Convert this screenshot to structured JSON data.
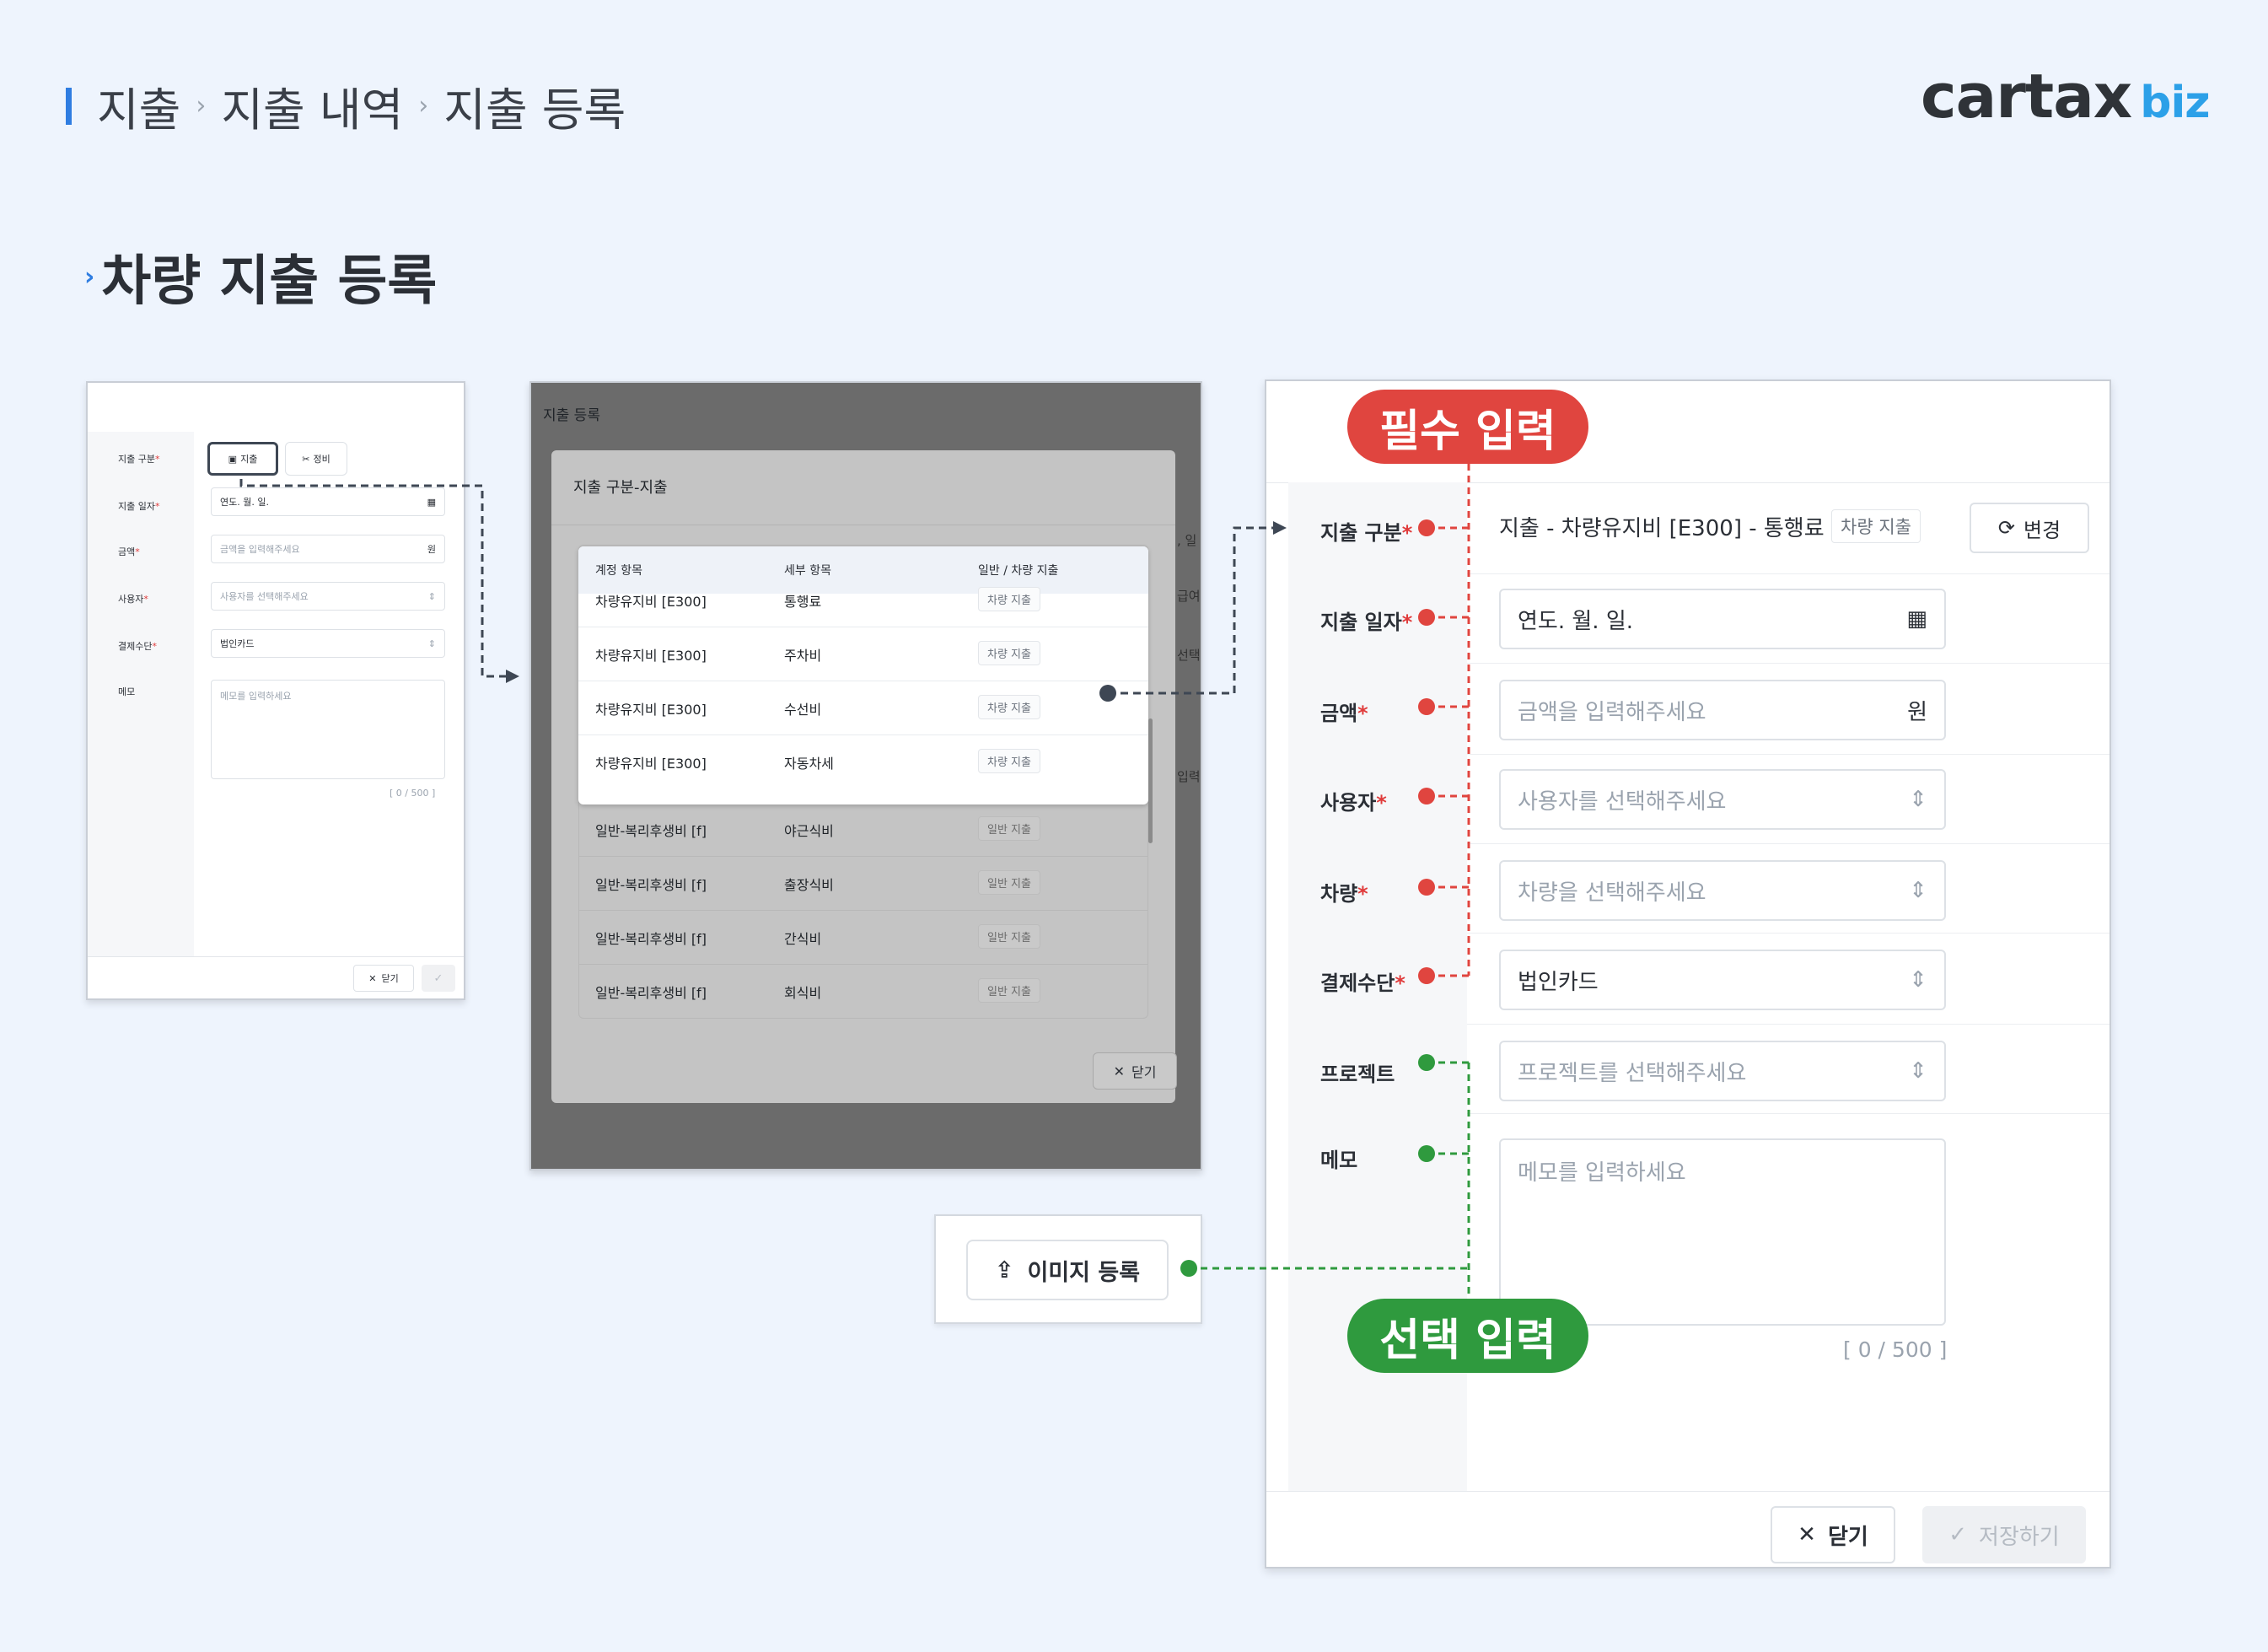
{
  "breadcrumb": {
    "items": [
      "지출",
      "지출 내역",
      "지출 등록"
    ]
  },
  "logo": {
    "text": "cartax",
    "suffix": "biz"
  },
  "section_title": "차량 지출 등록",
  "small_form": {
    "labels": {
      "category": "지출 구분",
      "date": "지출 일자",
      "amount": "금액",
      "user": "사용자",
      "payment": "결제수단",
      "memo": "메모"
    },
    "req_mark": "*",
    "switch_expense": "지출",
    "switch_maintenance": "정비",
    "date_value": "연도. 월. 일.",
    "amount_placeholder": "금액을 입력해주세요",
    "amount_unit": "원",
    "user_placeholder": "사용자를 선택해주세요",
    "payment_value": "법인카드",
    "memo_placeholder": "메모를 입력하세요",
    "memo_counter": "[ 0 / 500 ]",
    "close_label": "닫기"
  },
  "modal": {
    "page_title": "지출 등록",
    "title": "지출 구분-지출",
    "columns": [
      "계정 항목",
      "세부 항목",
      "일반 / 차량 지출"
    ],
    "rows": [
      {
        "account": "차량유지비 [E300]",
        "detail": "통행료",
        "type": "차량 지출"
      },
      {
        "account": "차량유지비 [E300]",
        "detail": "주차비",
        "type": "차량 지출"
      },
      {
        "account": "차량유지비 [E300]",
        "detail": "수선비",
        "type": "차량 지출"
      },
      {
        "account": "차량유지비 [E300]",
        "detail": "자동차세",
        "type": "차량 지출"
      },
      {
        "account": "일반-복리후생비 [f]",
        "detail": "야근식비",
        "type": "일반 지출"
      },
      {
        "account": "일반-복리후생비 [f]",
        "detail": "출장식비",
        "type": "일반 지출"
      },
      {
        "account": "일반-복리후생비 [f]",
        "detail": "간식비",
        "type": "일반 지출"
      },
      {
        "account": "일반-복리후생비 [f]",
        "detail": "회식비",
        "type": "일반 지출"
      }
    ],
    "close_label": "닫기"
  },
  "upload": {
    "label": "이미지 등록"
  },
  "large_form": {
    "labels": {
      "category": "지출 구분",
      "date": "지출 일자",
      "amount": "금액",
      "user": "사용자",
      "vehicle": "차량",
      "payment": "결제수단",
      "project": "프로젝트",
      "memo": "메모"
    },
    "req_mark": "*",
    "category_value": "지출 - 차량유지비 [E300] - 통행료",
    "category_tag": "차량 지출",
    "change_label": "변경",
    "date_value": "연도. 월. 일.",
    "amount_placeholder": "금액을 입력해주세요",
    "amount_unit": "원",
    "user_placeholder": "사용자를 선택해주세요",
    "vehicle_placeholder": "차량을 선택해주세요",
    "payment_value": "법인카드",
    "project_placeholder": "프로젝트를 선택해주세요",
    "memo_placeholder": "메모를 입력하세요",
    "memo_counter": "[ 0 / 500 ]",
    "close_label": "닫기",
    "save_label": "저장하기"
  },
  "annotations": {
    "required": "필수 입력",
    "optional": "선택 입력"
  },
  "colors": {
    "required": "#e0453f",
    "optional": "#2f9a3e",
    "accent": "#2f7de1",
    "connector": "#3e4754"
  }
}
